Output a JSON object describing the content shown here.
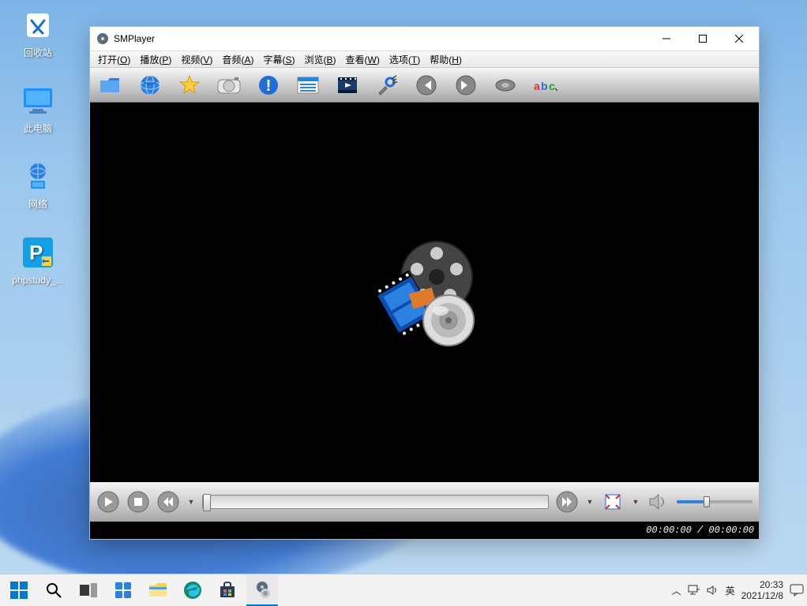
{
  "desktop": {
    "icons": [
      {
        "name": "recycle-bin",
        "label": "回收站"
      },
      {
        "name": "this-pc",
        "label": "此电脑"
      },
      {
        "name": "network",
        "label": "网络"
      },
      {
        "name": "phpstudy",
        "label": "phpstudy_..."
      }
    ]
  },
  "window": {
    "title": "SMPlayer",
    "menus": [
      {
        "label": "打开",
        "accel": "O"
      },
      {
        "label": "播放",
        "accel": "P"
      },
      {
        "label": "视频",
        "accel": "V"
      },
      {
        "label": "音频",
        "accel": "A"
      },
      {
        "label": "字幕",
        "accel": "S"
      },
      {
        "label": "浏览",
        "accel": "B"
      },
      {
        "label": "查看",
        "accel": "W"
      },
      {
        "label": "选项",
        "accel": "T"
      },
      {
        "label": "帮助",
        "accel": "H"
      }
    ],
    "status": {
      "time_display": "00:00:00 / 00:00:00",
      "current": "00:00:00",
      "separator": "/",
      "total": "00:00:00"
    },
    "playback": {
      "seek_position_pct": 0,
      "volume_pct": 35
    }
  },
  "taskbar": {
    "ime": "英",
    "net_icon": "network-icon",
    "sound_icon": "sound-icon",
    "time": "20:33",
    "date": "2021/12/8"
  }
}
